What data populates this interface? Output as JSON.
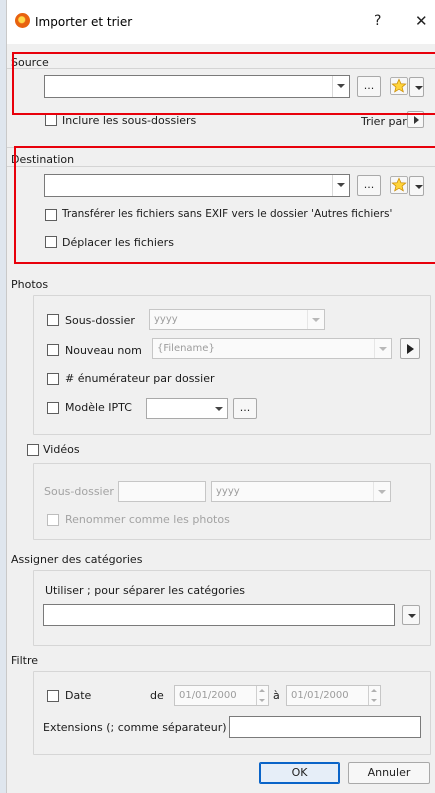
{
  "window": {
    "title": "Importer et trier",
    "help": "?",
    "close": "✕"
  },
  "source": {
    "title": "Source",
    "include_subfolders": "Inclure les sous-dossiers",
    "sort_by": "Trier par",
    "browse": "..."
  },
  "destination": {
    "title": "Destination",
    "browse": "...",
    "move_non_exif": "Transférer les fichiers sans EXIF vers le dossier 'Autres fichiers'",
    "move_files": "Déplacer les fichiers"
  },
  "photos": {
    "title": "Photos",
    "subfolder_label": "Sous-dossier",
    "subfolder_value": "yyyy",
    "new_name_label": "Nouveau nom",
    "new_name_value": "{Filename}",
    "enumerator_label": "# énumérateur par dossier",
    "iptc_label": "Modèle IPTC",
    "iptc_browse": "..."
  },
  "videos": {
    "title": "Vidéos",
    "subfolder_label": "Sous-dossier",
    "subfolder_value": "yyyy",
    "rename_label": "Renommer comme les photos"
  },
  "categories": {
    "title": "Assigner des catégories",
    "hint": "Utiliser ; pour séparer les catégories"
  },
  "filter": {
    "title": "Filtre",
    "date_label": "Date",
    "from_label": "de",
    "from_value": "01/01/2000",
    "to_label": "à",
    "to_value": "01/01/2000",
    "extensions_label": "Extensions (; comme séparateur)"
  },
  "footer": {
    "ok": "OK",
    "cancel": "Annuler"
  },
  "colors": {
    "highlight": "#e8000b",
    "background": "#f0f0f0",
    "focus": "#0a64c8"
  }
}
